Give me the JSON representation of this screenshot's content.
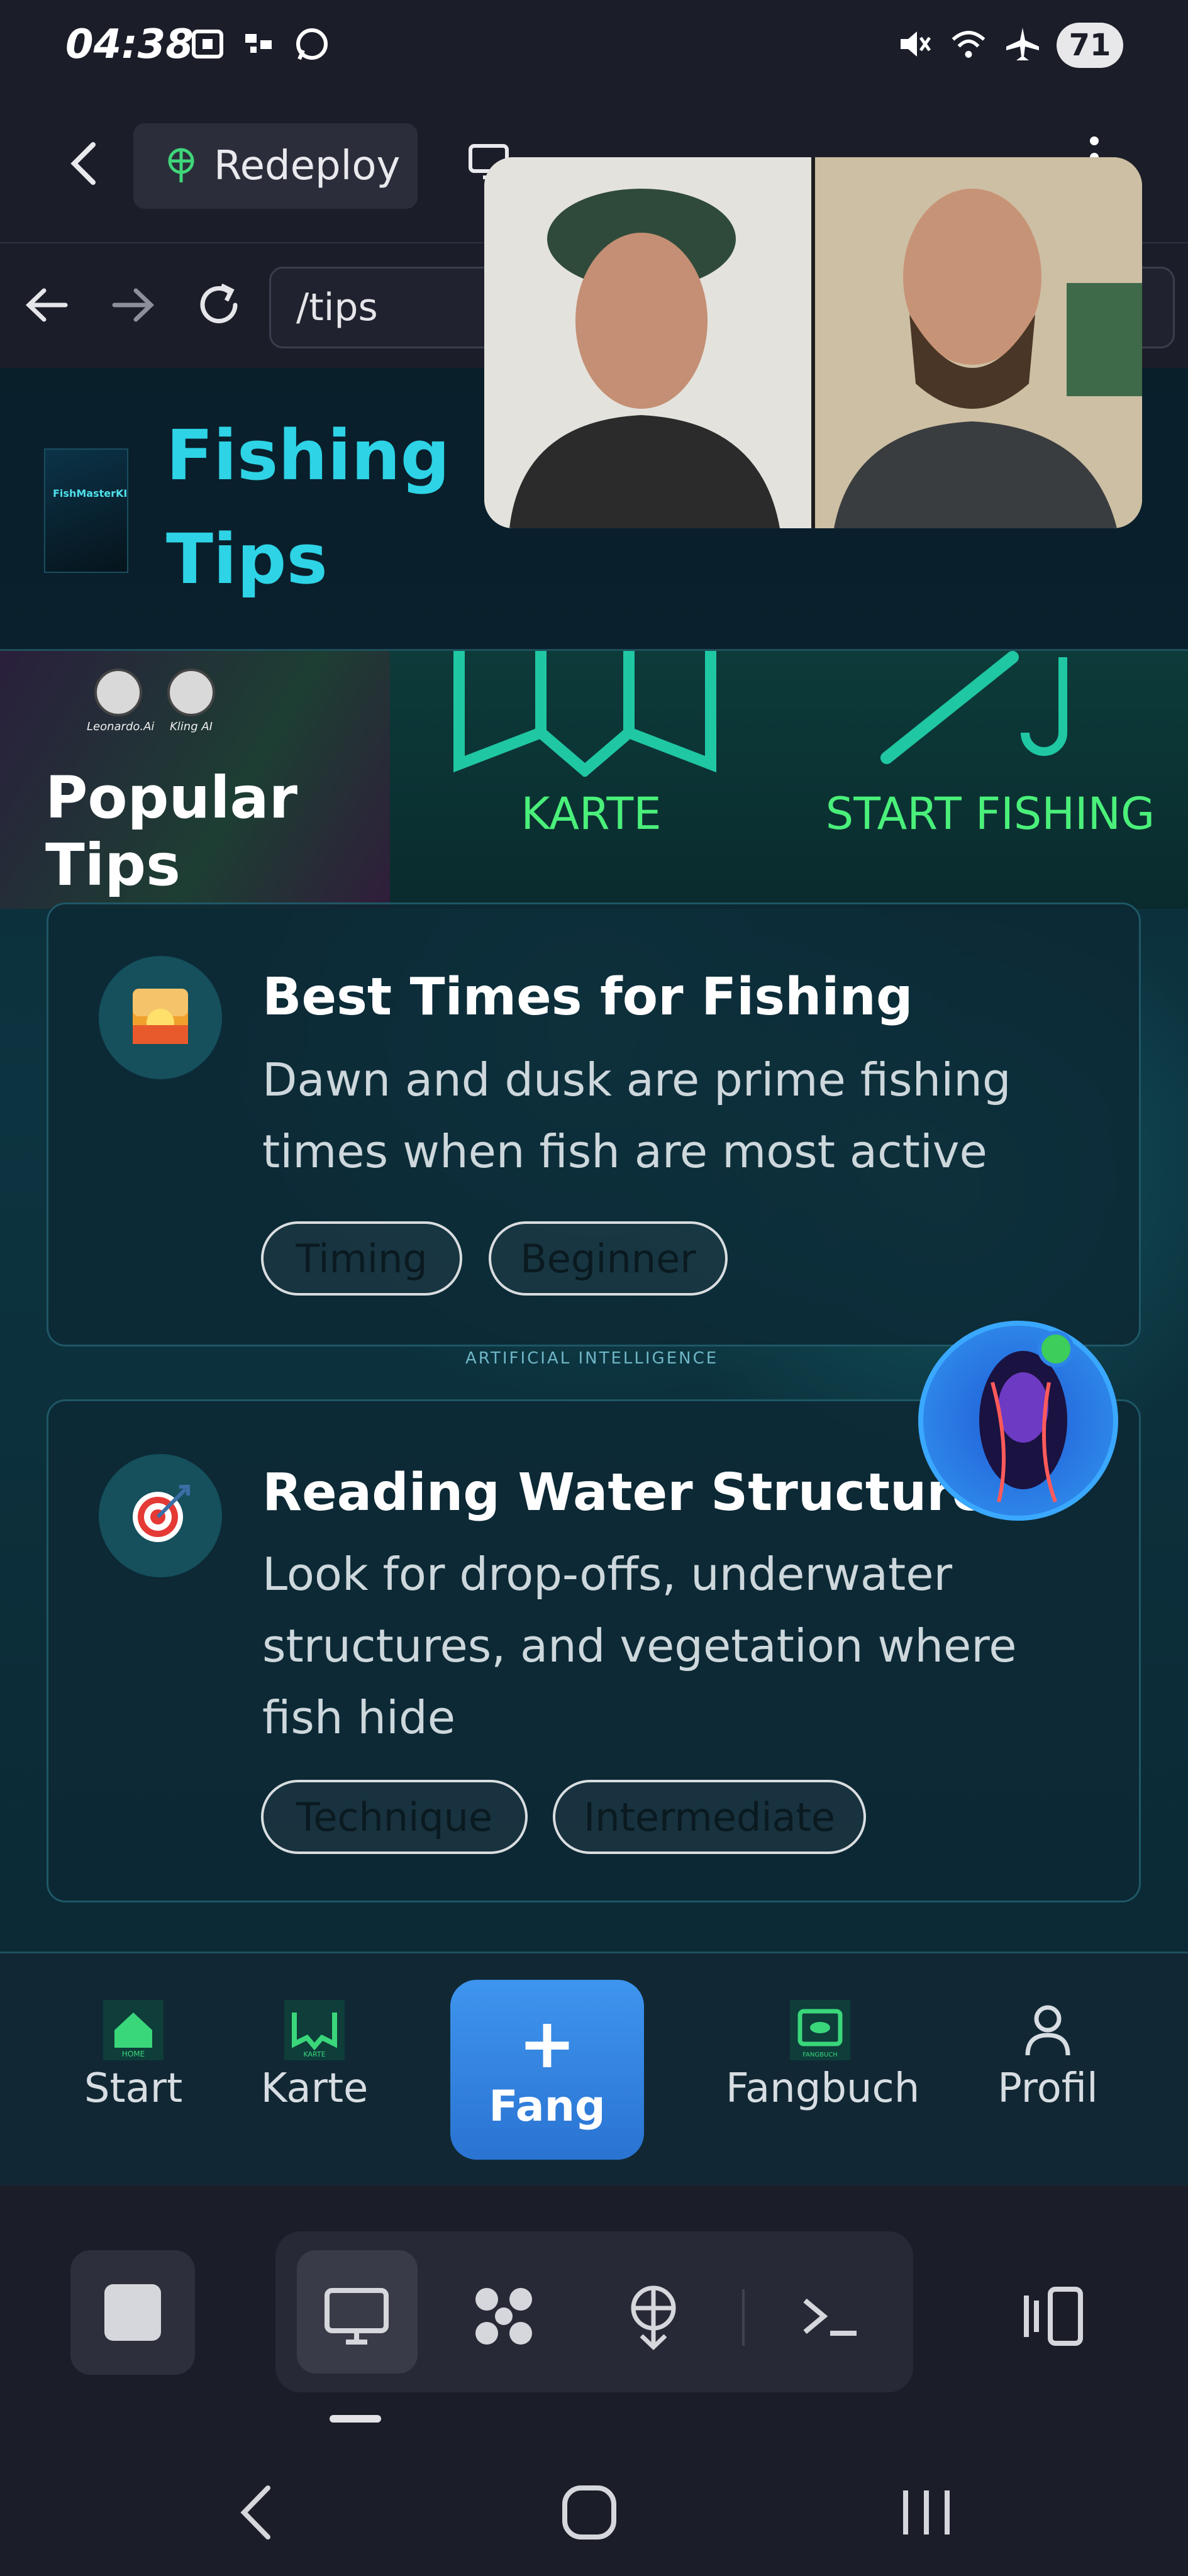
{
  "status_bar": {
    "time": "04:38",
    "battery": "71"
  },
  "app_bar": {
    "redeploy_label": "Redeploy"
  },
  "browser": {
    "url": "/tips"
  },
  "page": {
    "title_line_1": "Fishing",
    "title_line_2": "Tips",
    "logo_text": "FishMasterKI",
    "tiles": {
      "popular_label": "Popular Tips",
      "badge_1_caption": "Leonardo.Ai",
      "badge_2_caption": "Kling AI",
      "karte_label": "KARTE",
      "start_label": "START FISHING"
    },
    "tips": [
      {
        "icon": "sunrise-icon",
        "title": "Best Times for Fishing",
        "description": "Dawn and dusk are prime fishing times when fish are most active",
        "tags": [
          "Timing",
          "Beginner"
        ]
      },
      {
        "icon": "target-icon",
        "title": "Reading Water Structure",
        "description": "Look for drop-offs, underwater structures, and vegetation where fish hide",
        "tags": [
          "Technique",
          "Intermediate"
        ]
      }
    ],
    "bg_banner_text": "ARTIFICIAL INTELLIGENCE"
  },
  "bottom_nav": {
    "items": [
      {
        "label": "Start",
        "icon": "home-icon",
        "icon_caption": "HOME"
      },
      {
        "label": "Karte",
        "icon": "map-icon",
        "icon_caption": "KARTE"
      },
      {
        "label": "Fang",
        "icon": "plus-icon"
      },
      {
        "label": "Fangbuch",
        "icon": "logbook-icon",
        "icon_caption": "FANGBUCH"
      },
      {
        "label": "Profil",
        "icon": "user-icon"
      }
    ]
  },
  "colors": {
    "accent_cyan": "#2ed3e6",
    "accent_green": "#4af07a",
    "primary_blue": "#3e95ee",
    "background": "#1b1e29"
  }
}
